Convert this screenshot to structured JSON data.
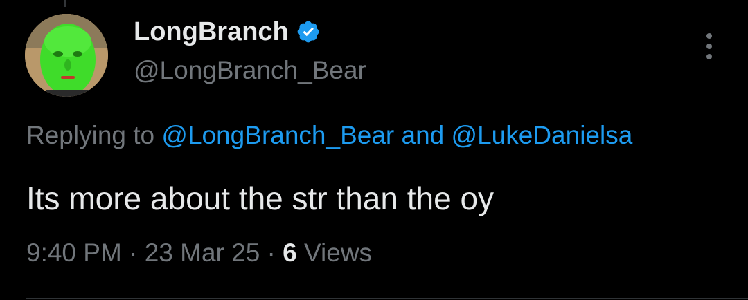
{
  "author": {
    "display_name": "LongBranch",
    "handle": "@LongBranch_Bear",
    "verified_icon": "verified-badge-icon",
    "avatar_icon": "profile-avatar"
  },
  "reply": {
    "prefix": "Replying to ",
    "mention_1": "@LongBranch_Bear",
    "conjunction": " and ",
    "mention_2": "@LukeDanielsa"
  },
  "tweet": {
    "text": "Its more about the str than the oy"
  },
  "meta": {
    "time": "9:40 PM",
    "separator": " · ",
    "date": "23 Mar 25",
    "views_count": "6",
    "views_label": " Views"
  },
  "colors": {
    "background": "#000000",
    "primary_text": "#e7e9ea",
    "secondary_text": "#71767b",
    "link": "#1d9bf0",
    "verified": "#1d9bf0"
  }
}
